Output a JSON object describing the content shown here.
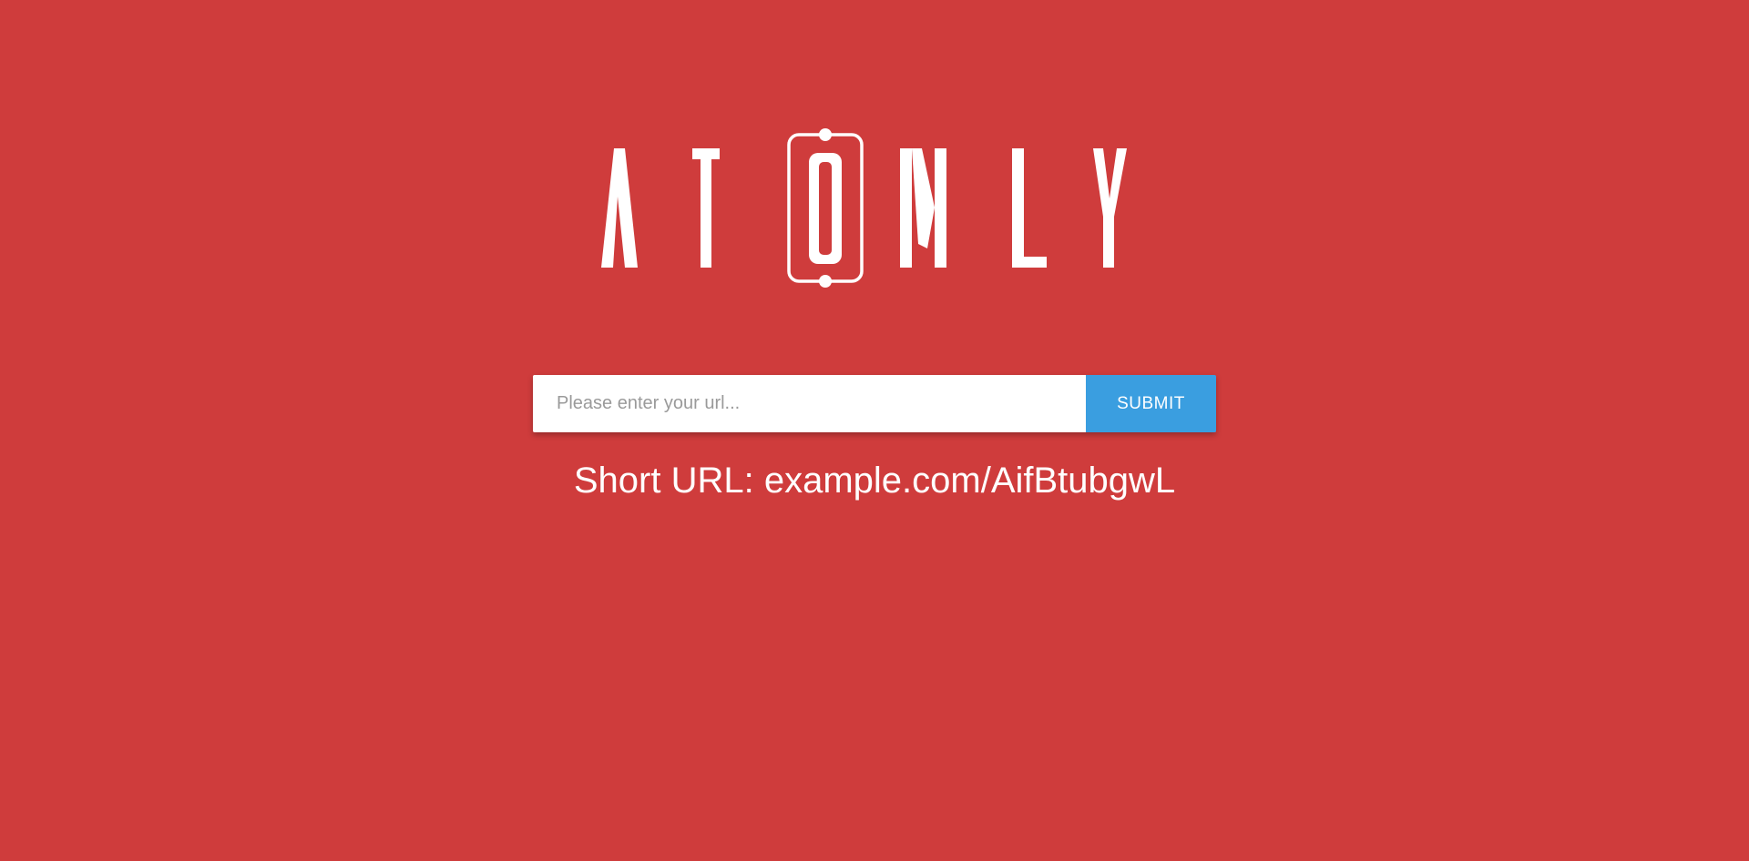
{
  "app": {
    "logo_text": "ATOMLY"
  },
  "form": {
    "url_placeholder": "Please enter your url...",
    "url_value": "",
    "submit_label": "SUBMIT"
  },
  "result": {
    "label": "Short URL:",
    "short_url": "example.com/AifBtubgwL"
  },
  "colors": {
    "background": "#cf3c3c",
    "button": "#3a9ee0",
    "text": "#ffffff"
  }
}
